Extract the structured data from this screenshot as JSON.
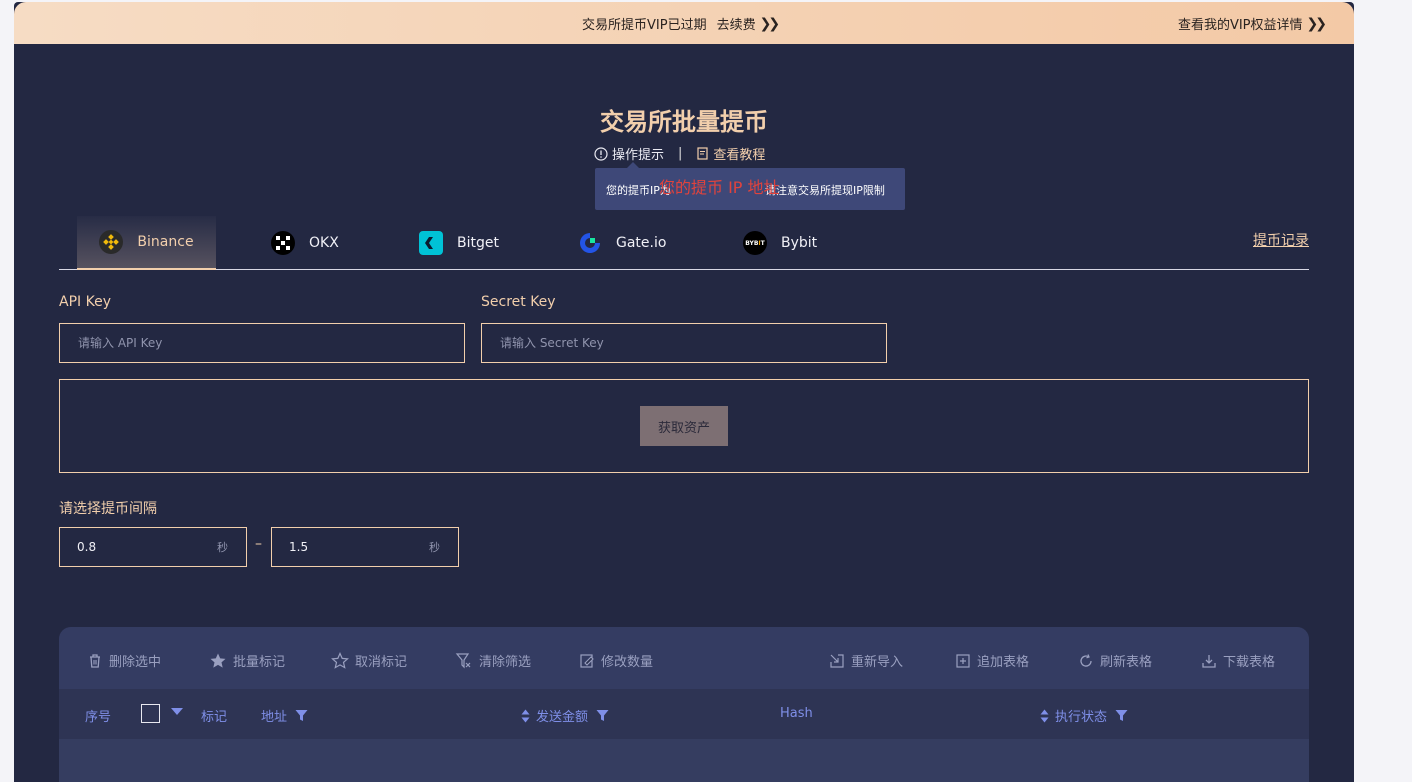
{
  "vip": {
    "expired_text": "交易所提币VIP已过期",
    "renew_link": "去续费",
    "rights_link": "查看我的VIP权益详情"
  },
  "page": {
    "title": "交易所批量提币",
    "op_hint": "操作提示",
    "tutorial": "查看教程"
  },
  "tooltip": {
    "left_text": "您的提币IP为",
    "right_text": "请注意交易所提现IP限制",
    "red_text": "您的提币 IP 地址"
  },
  "tabs": [
    {
      "label": "Binance",
      "icon": "binance-icon",
      "active": true
    },
    {
      "label": "OKX",
      "icon": "okx-icon"
    },
    {
      "label": "Bitget",
      "icon": "bitget-icon"
    },
    {
      "label": "Gate.io",
      "icon": "gateio-icon"
    },
    {
      "label": "Bybit",
      "icon": "bybit-icon"
    }
  ],
  "record_link": "提币记录",
  "api_key": {
    "label": "API Key",
    "placeholder": "请输入 API Key"
  },
  "secret_key": {
    "label": "Secret Key",
    "placeholder": "请输入 Secret Key"
  },
  "get_assets_button": "获取资产",
  "interval": {
    "label": "请选择提币间隔",
    "min": "0.8",
    "max": "1.5",
    "unit": "秒",
    "dash": "–"
  },
  "toolbar": {
    "delete": "删除选中",
    "batch_mark": "批量标记",
    "unmark": "取消标记",
    "clear_filter": "清除筛选",
    "modify_amount": "修改数量",
    "reimport": "重新导入",
    "append_table": "追加表格",
    "refresh_table": "刷新表格",
    "download_table": "下载表格"
  },
  "table_headers": {
    "index": "序号",
    "mark": "标记",
    "address": "地址",
    "amount": "发送金额",
    "hash": "Hash",
    "status": "执行状态"
  },
  "colors": {
    "accent": "#f2cfac",
    "header_blue": "#7f8fe8",
    "background": "#232842"
  }
}
